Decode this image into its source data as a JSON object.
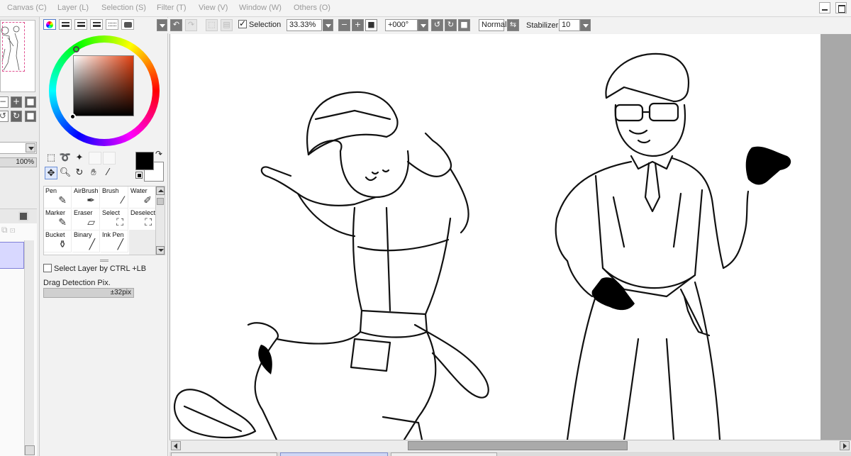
{
  "menubar": {
    "items": [
      "Canvas (C)",
      "Layer (L)",
      "Selection (S)",
      "Filter (T)",
      "View (V)",
      "Window (W)",
      "Others (O)"
    ]
  },
  "navigator": {
    "opacity": "100%"
  },
  "toolbar": {
    "selection_label": "Selection",
    "selection_checked": true,
    "zoom": "33.33%",
    "rotation": "+000°",
    "blend_mode": "Normal",
    "stabilizer_label": "Stabilizer",
    "stabilizer_value": "10"
  },
  "color_panel": {
    "foreground": "#000000",
    "background": "#ffffff"
  },
  "brushes": [
    {
      "label": "Pen",
      "icon": "pen-icon"
    },
    {
      "label": "AirBrush",
      "icon": "airbrush-icon"
    },
    {
      "label": "Brush",
      "icon": "brush-icon"
    },
    {
      "label": "Water",
      "icon": "water-icon"
    },
    {
      "label": "Marker",
      "icon": "marker-icon"
    },
    {
      "label": "Eraser",
      "icon": "eraser-icon"
    },
    {
      "label": "Select",
      "icon": "select-icon"
    },
    {
      "label": "Deselect",
      "icon": "deselect-icon"
    },
    {
      "label": "Bucket",
      "icon": "bucket-icon"
    },
    {
      "label": "Binary",
      "icon": "binary-icon"
    },
    {
      "label": "Ink Pen",
      "icon": "ink-pen-icon"
    }
  ],
  "tool_options": {
    "select_layer_label": "Select Layer by CTRL +LB",
    "select_layer_checked": false,
    "drag_detection_label": "Drag Detection Pix.",
    "drag_detection_value": "±32pix"
  },
  "window": {
    "accent": "#5078c8"
  }
}
